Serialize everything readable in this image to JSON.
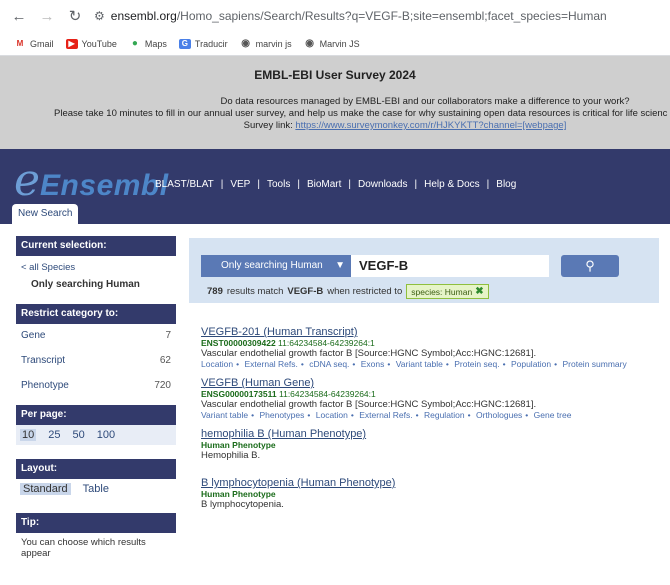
{
  "browser": {
    "url_host": "ensembl.org",
    "url_path": "/Homo_sapiens/Search/Results?q=VEGF-B;site=ensembl;facet_species=Human",
    "bookmarks": [
      {
        "label": "Gmail",
        "icon": "gmail-icon"
      },
      {
        "label": "YouTube",
        "icon": "youtube-icon"
      },
      {
        "label": "Maps",
        "icon": "maps-icon"
      },
      {
        "label": "Traducir",
        "icon": "translate-icon"
      },
      {
        "label": "marvin js",
        "icon": "globe-icon"
      },
      {
        "label": "Marvin JS",
        "icon": "globe-icon"
      }
    ]
  },
  "survey": {
    "title": "EMBL-EBI User Survey 2024",
    "line1": "Do data resources managed by EMBL-EBI and our collaborators make a difference to your work?",
    "line2": "Please take 10 minutes to fill in our annual user survey, and help us make the case for why sustaining open data resources is critical for life scienc",
    "link_prefix": "Survey link: ",
    "link": "https://www.surveymonkey.com/r/HJKYKTT?channel=[webpage]"
  },
  "masthead": {
    "logo_e": "e",
    "logo_text": "Ensembl",
    "links": [
      "BLAST/BLAT",
      "VEP",
      "Tools",
      "BioMart",
      "Downloads",
      "Help & Docs",
      "Blog"
    ],
    "new_search": "New Search"
  },
  "sidebar": {
    "selection_title": "Current selection:",
    "all_species": "< all Species",
    "current": "Only searching Human",
    "restrict_title": "Restrict category to:",
    "categories": [
      {
        "label": "Gene",
        "count": "7"
      },
      {
        "label": "Transcript",
        "count": "62"
      },
      {
        "label": "Phenotype",
        "count": "720"
      }
    ],
    "perpage_title": "Per page:",
    "perpage": [
      "10",
      "25",
      "50",
      "100"
    ],
    "layout_title": "Layout:",
    "layout": [
      "Standard",
      "Table"
    ],
    "tip_title": "Tip:",
    "tip_text": "You can choose which results appear"
  },
  "search": {
    "scope": "Only searching Human",
    "query": "VEGF-B",
    "count": "789",
    "count_text": "results match",
    "count_term": "VEGF-B",
    "count_suffix": "when restricted to",
    "facet": "species: Human"
  },
  "results": [
    {
      "title": "VEGFB-201 (Human Transcript)",
      "id": "ENST00000309422",
      "loc": "11:64234584-64239264:1",
      "desc": "Vascular endothelial growth factor B [Source:HGNC Symbol;Acc:HGNC:12681].",
      "links": [
        "Location",
        "External Refs.",
        "cDNA seq.",
        "Exons",
        "Variant table",
        "Protein seq.",
        "Population",
        "Protein summary"
      ]
    },
    {
      "title": "VEGFB (Human Gene)",
      "id": "ENSG00000173511",
      "loc": "11:64234584-64239264:1",
      "desc": "Vascular endothelial growth factor B [Source:HGNC Symbol;Acc:HGNC:12681].",
      "links": [
        "Variant table",
        "Phenotypes",
        "Location",
        "External Refs.",
        "Regulation",
        "Orthologues",
        "Gene tree"
      ]
    },
    {
      "title": "hemophilia B (Human Phenotype)",
      "type": "Human Phenotype",
      "desc": "Hemophilia B."
    },
    {
      "title": "B lymphocytopenia (Human Phenotype)",
      "type": "Human Phenotype",
      "desc": "B lymphocytopenia."
    }
  ]
}
